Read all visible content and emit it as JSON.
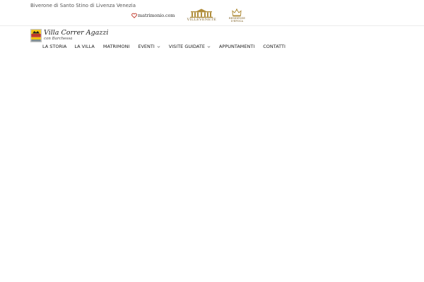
{
  "topbar": {
    "address": "Biverone di Santo Stino di Livenza Venezia"
  },
  "partners": {
    "matrimonio": "matrimonio.com",
    "villevenete": "VILLEVENETE",
    "epoca_line1": "RESIDENZE",
    "epoca_line2": "D'EPOCA"
  },
  "brand": {
    "title": "Villa Correr Agazzi",
    "subtitle": "con Barchessa"
  },
  "nav": {
    "items": [
      {
        "label": "LA STORIA"
      },
      {
        "label": "LA VILLA"
      },
      {
        "label": "MATRIMONI"
      },
      {
        "label": "EVENTI",
        "icon": "chevron-down-icon"
      },
      {
        "label": "VISITE GUIDATE",
        "icon": "chevron-down-icon"
      },
      {
        "label": "APPUNTAMENTI"
      },
      {
        "label": "CONTATTI"
      }
    ]
  },
  "colors": {
    "heart": "#c0392b",
    "gold": "#b08d3a",
    "crest_red": "#c0392b",
    "crest_yellow": "#f1c40f"
  }
}
